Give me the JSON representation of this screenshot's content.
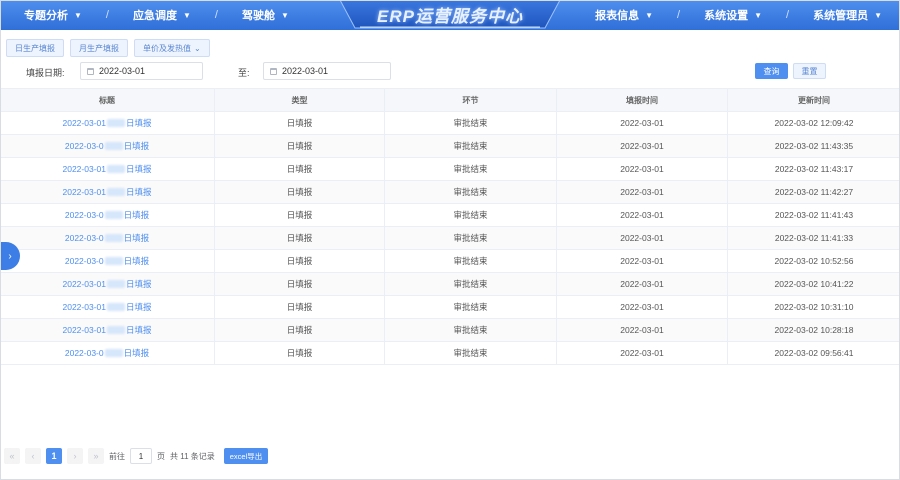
{
  "header": {
    "brand_title": "ERP运营服务中心",
    "left_nav": [
      {
        "label": "专题分析"
      },
      {
        "label": "应急调度"
      },
      {
        "label": "驾驶舱"
      }
    ],
    "right_nav": [
      {
        "label": "报表信息"
      },
      {
        "label": "系统设置"
      },
      {
        "label": "系统管理员"
      }
    ],
    "separator": "/"
  },
  "tabs": [
    {
      "label": "日生产填报"
    },
    {
      "label": "月生产填报"
    },
    {
      "label": "单价及发热值"
    }
  ],
  "filter": {
    "date_label": "填报日期:",
    "start_date": "2022-03-01",
    "to_label": "至:",
    "end_date": "2022-03-01",
    "query_label": "查询",
    "reset_label": "重置"
  },
  "table": {
    "columns": [
      "标题",
      "类型",
      "环节",
      "填报时间",
      "更新时间"
    ],
    "rows": [
      {
        "title_prefix": "2022-03-01",
        "title_suffix": "日填报",
        "type": "日填报",
        "stage": "审批结束",
        "fill_time": "2022-03-01",
        "update_time": "2022-03-02 12:09:42"
      },
      {
        "title_prefix": "2022-03-0",
        "title_suffix": "日填报",
        "type": "日填报",
        "stage": "审批结束",
        "fill_time": "2022-03-01",
        "update_time": "2022-03-02 11:43:35"
      },
      {
        "title_prefix": "2022-03-01",
        "title_suffix": "日填报",
        "type": "日填报",
        "stage": "审批结束",
        "fill_time": "2022-03-01",
        "update_time": "2022-03-02 11:43:17"
      },
      {
        "title_prefix": "2022-03-01",
        "title_suffix": "日填报",
        "type": "日填报",
        "stage": "审批结束",
        "fill_time": "2022-03-01",
        "update_time": "2022-03-02 11:42:27"
      },
      {
        "title_prefix": "2022-03-0",
        "title_suffix": "日填报",
        "type": "日填报",
        "stage": "审批结束",
        "fill_time": "2022-03-01",
        "update_time": "2022-03-02 11:41:43"
      },
      {
        "title_prefix": "2022-03-0",
        "title_suffix": "日填报",
        "type": "日填报",
        "stage": "审批结束",
        "fill_time": "2022-03-01",
        "update_time": "2022-03-02 11:41:33"
      },
      {
        "title_prefix": "2022-03-0",
        "title_suffix": "日填报",
        "type": "日填报",
        "stage": "审批结束",
        "fill_time": "2022-03-01",
        "update_time": "2022-03-02 10:52:56"
      },
      {
        "title_prefix": "2022-03-01",
        "title_suffix": "日填报",
        "type": "日填报",
        "stage": "审批结束",
        "fill_time": "2022-03-01",
        "update_time": "2022-03-02 10:41:22"
      },
      {
        "title_prefix": "2022-03-01",
        "title_suffix": "日填报",
        "type": "日填报",
        "stage": "审批结束",
        "fill_time": "2022-03-01",
        "update_time": "2022-03-02 10:31:10"
      },
      {
        "title_prefix": "2022-03-01",
        "title_suffix": "日填报",
        "type": "日填报",
        "stage": "审批结束",
        "fill_time": "2022-03-01",
        "update_time": "2022-03-02 10:28:18"
      },
      {
        "title_prefix": "2022-03-0",
        "title_suffix": "日填报",
        "type": "日填报",
        "stage": "审批结束",
        "fill_time": "2022-03-01",
        "update_time": "2022-03-02 09:56:41"
      }
    ]
  },
  "pagination": {
    "first_icon": "«",
    "prev_icon": "‹",
    "current_page": "1",
    "next_icon": "›",
    "last_icon": "»",
    "goto_label": "前往",
    "goto_value": "1",
    "page_unit": "页",
    "total_text": "共 11 条记录",
    "export_label": "excel导出"
  },
  "side_toggle": {
    "icon": "›"
  },
  "colors": {
    "primary": "#4f8ff0",
    "header_bg": "#2f6fd8",
    "link": "#4f8ff0"
  },
  "icons": {
    "calendar": "calendar-icon",
    "caret": "caret-down-icon",
    "chevron": "chevron-down-icon"
  }
}
